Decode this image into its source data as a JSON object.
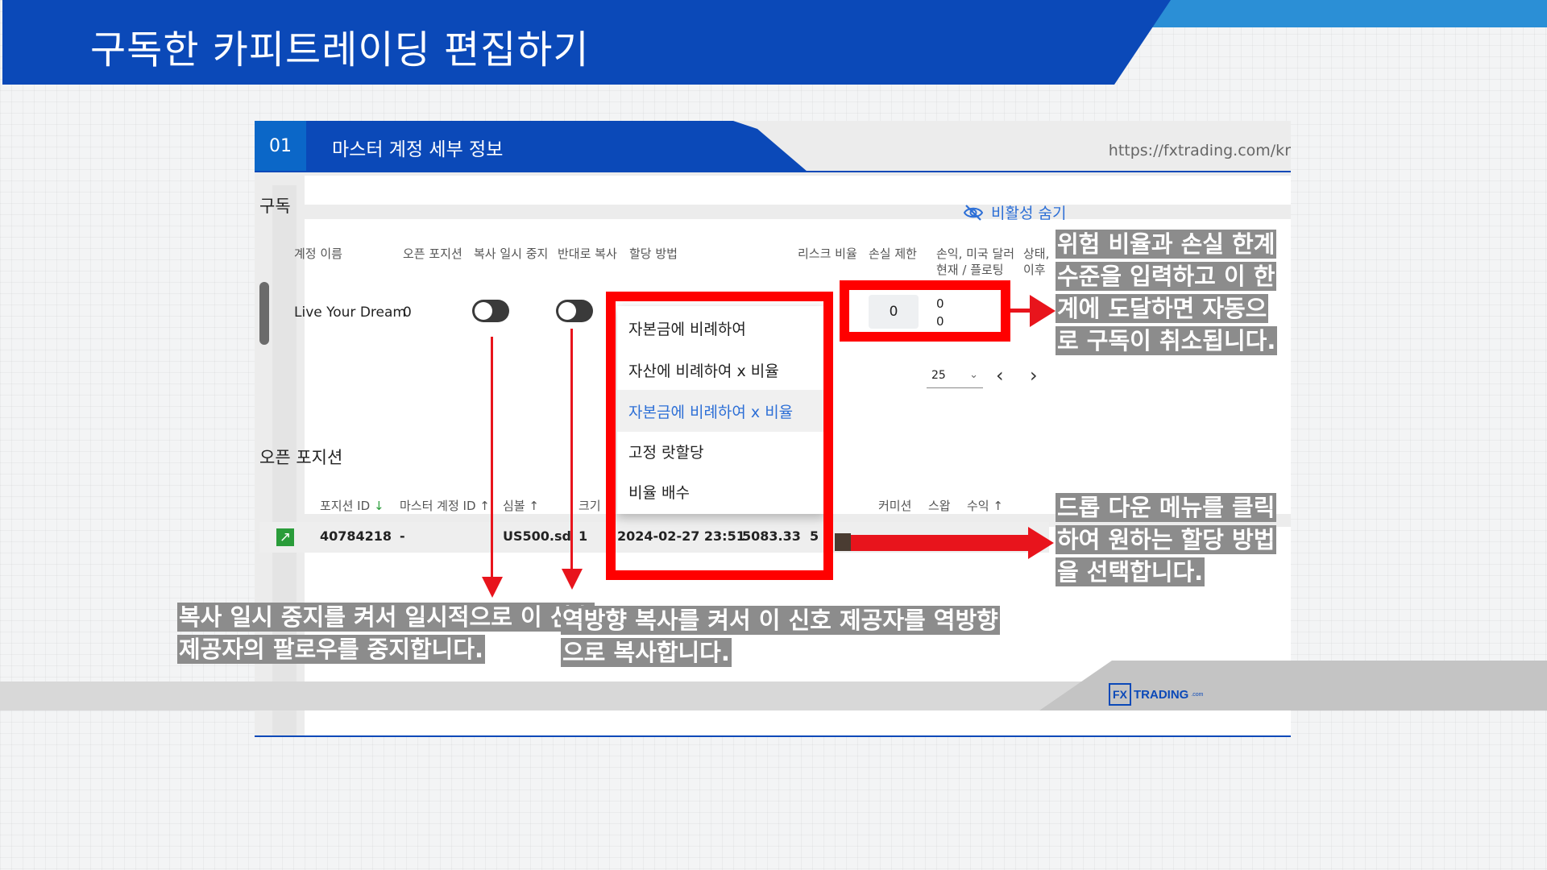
{
  "slide": {
    "title": "구독한 카피트레이딩 편집하기"
  },
  "section": {
    "number": "01",
    "label": "마스터 계정 세부 정보",
    "url": "https://fxtrading.com/kr"
  },
  "subscription": {
    "title": "구독",
    "hide_inactive_label": "비활성 숨기",
    "columns": {
      "account_name": "계정 이름",
      "open_positions": "오픈 포지션",
      "pause_copy": "복사 일시 중지",
      "reverse_copy": "반대로 복사",
      "allocation": "할당 방법",
      "risk_ratio": "리스크 비율",
      "loss_limit": "손실 제한",
      "pnl_line1": "손익, 미국 달러",
      "pnl_line2": "현재 / 플로팅",
      "status_line1": "상태,",
      "status_line2": "이후"
    },
    "row": {
      "account_name": "Live Your Dream",
      "open_positions": "0",
      "pause_copy_on": false,
      "reverse_copy_on": false,
      "loss_limit_value": "0",
      "pnl_current": "0",
      "pnl_floating": "0"
    },
    "page_size": "25"
  },
  "allocation_dropdown": {
    "options": [
      "자본금에 비례하여",
      "자산에 비례하여 x 비율",
      "자본금에 비례하여 x 비율",
      "고정 랏할당",
      "비율 배수"
    ],
    "selected": "자본금에 비례하여 x 비율"
  },
  "open_positions": {
    "title": "오픈 포지션",
    "columns": {
      "position_id": "포지션 ID",
      "master_account_id": "마스터 계정 ID",
      "symbol": "심볼",
      "size": "크기",
      "commission": "커미션",
      "swap": "스왑",
      "profit": "수익"
    },
    "row": {
      "position_id": "40784218",
      "master_account_id": "-",
      "symbol": "US500.sd",
      "size": "1",
      "open_time": "2024-02-27 23:51",
      "open_price": "5083.33",
      "current_price_partial": "5"
    }
  },
  "callouts": {
    "risk_lines": [
      "위험 비율과 손실 한계",
      "수준을 입력하고 이 한",
      "계에 도달하면 자동으",
      "로 구독이 취소됩니다."
    ],
    "dropdown_lines": [
      "드롭 다운 메뉴를 클릭",
      "하여 원하는 할당 방법",
      "을 선택합니다."
    ],
    "pause_lines": [
      "복사 일시 중지를 켜서 일시적으로 이 신호",
      "제공자의 팔로우를 중지합니다."
    ],
    "reverse_lines": [
      "역방향 복사를 켜서 이 신호 제공자를 역방향",
      "으로 복사합니다."
    ]
  },
  "footer": {
    "logo_box": "FX",
    "logo_text": "TRADING",
    "logo_suffix": ".com"
  },
  "colors": {
    "brand_blue": "#0b49b8",
    "highlight_red": "#ff0000",
    "accent_blue": "#2d6fd6"
  }
}
